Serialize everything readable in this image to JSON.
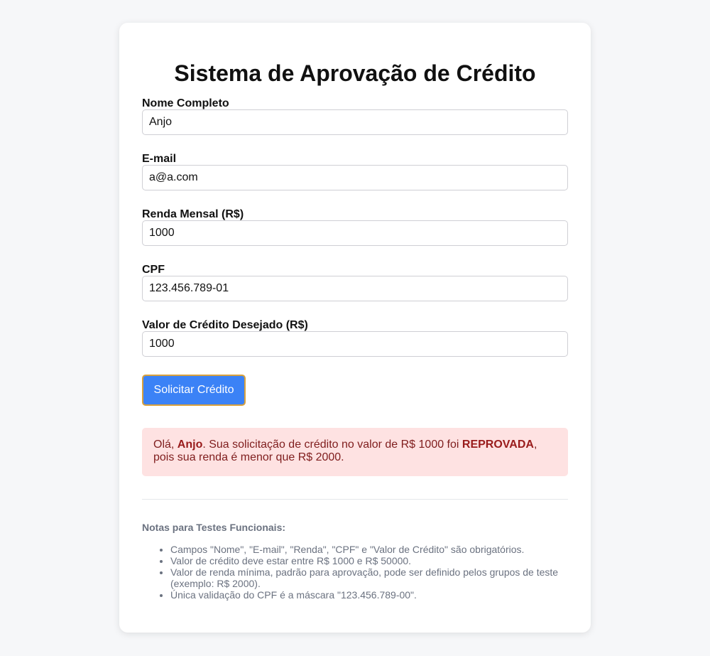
{
  "page": {
    "title": "Sistema de Aprovação de Crédito"
  },
  "form": {
    "fields": [
      {
        "label": "Nome Completo",
        "value": "Anjo"
      },
      {
        "label": "E-mail",
        "value": "a@a.com"
      },
      {
        "label": "Renda Mensal (R$)",
        "value": "1000"
      },
      {
        "label": "CPF",
        "value": "123.456.789-01"
      },
      {
        "label": "Valor de Crédito Desejado (R$)",
        "value": "1000"
      }
    ],
    "submit_label": "Solicitar Crédito"
  },
  "result": {
    "greeting": "Olá, ",
    "name": "Anjo",
    "text1": ". Sua solicitação de crédito no valor de R$ 1000 foi ",
    "status": "REPROVADA",
    "text2": ", pois sua renda é menor que R$ 2000."
  },
  "notes": {
    "title": "Notas para Testes Funcionais:",
    "items": [
      "Campos \"Nome\", \"E-mail\", \"Renda\", \"CPF\" e \"Valor de Crédito\" são obrigatórios.",
      "Valor de crédito deve estar entre R$ 1000 e R$ 50000.",
      "Valor de renda mínima, padrão para aprovação, pode ser definido pelos grupos de teste (exemplo: R$ 2000).",
      "Única validação do CPF é a máscara \"123.456.789-00\"."
    ]
  },
  "colors": {
    "accent": "#3b82f6",
    "error_background": "#fee2e2",
    "error_text": "#7f1d1d"
  }
}
